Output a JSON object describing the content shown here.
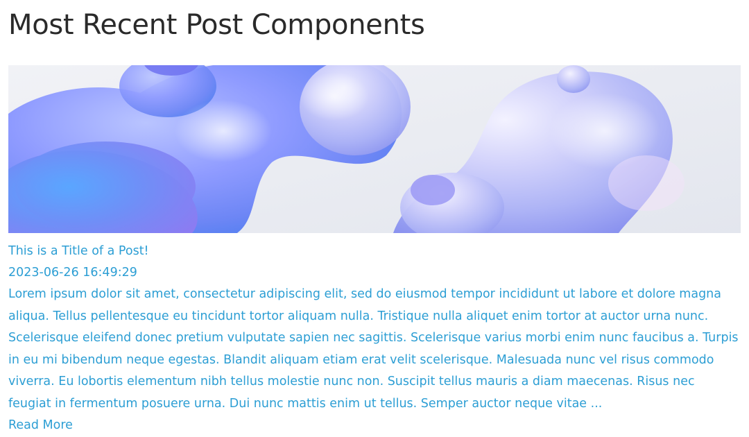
{
  "page": {
    "title": "Most Recent Post Components"
  },
  "post": {
    "image_alt": "abstract blue and purple 3D blob shapes",
    "title": "This is a Title of a Post!",
    "date": "2023-06-26 16:49:29",
    "excerpt": "Lorem ipsum dolor sit amet, consectetur adipiscing elit, sed do eiusmod tempor incididunt ut labore et dolore magna aliqua. Tellus pellentesque eu tincidunt tortor aliquam nulla. Tristique nulla aliquet enim tortor at auctor urna nunc. Scelerisque eleifend donec pretium vulputate sapien nec sagittis. Scelerisque varius morbi enim nunc faucibus a. Turpis in eu mi bibendum neque egestas. Blandit aliquam etiam erat velit scelerisque. Malesuada nunc vel risus commodo viverra. Eu lobortis elementum nibh tellus molestie nunc non. Suscipit tellus mauris a diam maecenas. Risus nec feugiat in fermentum posuere urna. Dui nunc mattis enim ut tellus. Semper auctor neque vitae ...",
    "read_more_label": "Read More"
  },
  "colors": {
    "link": "#2c9ed4",
    "heading": "#2a2a2a",
    "image_background": "#eceef3"
  }
}
